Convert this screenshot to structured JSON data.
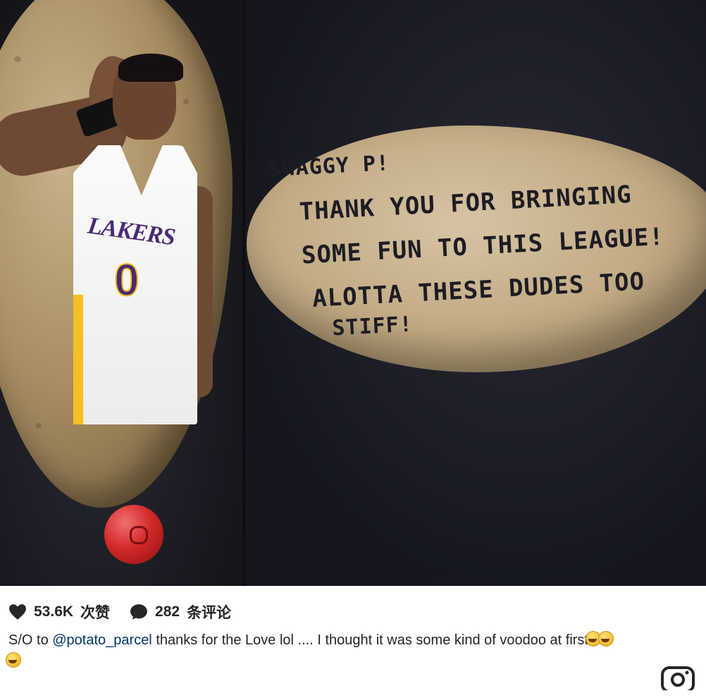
{
  "post": {
    "photo": {
      "potato_message": {
        "line1": "SWAGGY P!",
        "line2": "THANK YOU FOR BRINGING",
        "line3": "SOME FUN TO THIS LEAGUE!",
        "line4": "ALOTTA THESE DUDES TOO",
        "line5": "STIFF!"
      },
      "jersey_text": "LAKERS",
      "jersey_number": "0"
    },
    "stats": {
      "likes_count": "53.6K",
      "likes_label": "次赞",
      "comments_count": "282",
      "comments_label": "条评论"
    },
    "caption": {
      "prefix": "S/O to ",
      "mention": "@potato_parcel",
      "body": " thanks for the Love lol .... I thought it was some kind of voodoo at first"
    },
    "icons": {
      "like": "heart-icon",
      "comment": "comment-bubble-icon",
      "emoji": "laughing-crying-emoji",
      "instagram": "instagram-camera-icon"
    },
    "colors": {
      "text": "#262626",
      "mention": "#00376b",
      "jersey_purple": "#4a2a72",
      "jersey_gold": "#f5c020"
    }
  }
}
